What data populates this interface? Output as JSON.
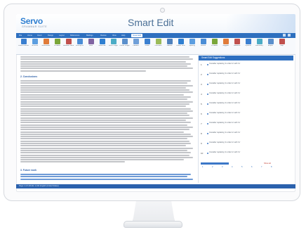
{
  "app": {
    "logo_text": "Servo",
    "logo_subtitle": "GRAMMAR SUITE",
    "title": "Smart Edit"
  },
  "tabs": [
    "File",
    "Home",
    "Insert",
    "Design",
    "Layout",
    "References",
    "Mailings",
    "Review",
    "View",
    "Help",
    "Smart Edit"
  ],
  "ribbon": {
    "buttons": [
      "Check Document",
      "Shortcut",
      "Redundant",
      "Phrases",
      "Misused Words",
      "Acronyms",
      "Lists",
      "Grammar",
      "Word Origin",
      "Check Single",
      "Passive",
      "Tense",
      "Numbers",
      "Names",
      "Check Term",
      "Spelling",
      "Words",
      "Phrases",
      "Suggest",
      "Statistics",
      "Options",
      "Dictionary",
      "Export",
      "Help"
    ]
  },
  "document": {
    "heading_1": "2. Conclusions",
    "heading_2": "3. Future work"
  },
  "panel": {
    "title": "Smart Edit Suggestions",
    "suggestions": [
      {
        "num": "1",
        "text": "Consider replacing 'in order to' with 'to'"
      },
      {
        "num": "2",
        "text": "Consider replacing 'in order to' with 'to'"
      },
      {
        "num": "3",
        "text": "Consider replacing 'in order to' with 'to'"
      },
      {
        "num": "4",
        "text": "Consider replacing 'in order to' with 'to'"
      },
      {
        "num": "5",
        "text": "Consider replacing 'in order to' with 'to'"
      },
      {
        "num": "6",
        "text": "Consider replacing 'in order to' with 'to'"
      },
      {
        "num": "7",
        "text": "Consider replacing 'in order to' with 'to'"
      },
      {
        "num": "8",
        "text": "Consider replacing 'in order to' with 'to'"
      },
      {
        "num": "9",
        "text": "Consider replacing 'in order to' with 'to'"
      },
      {
        "num": "10",
        "text": "Consider replacing 'in order to' with 'to'"
      }
    ],
    "pager_pages": [
      "1",
      "2",
      "3",
      "4",
      "5",
      "6",
      "7",
      "8"
    ],
    "pager_link": "Show all"
  },
  "status": {
    "text": "Page 1 of 6   Words: 2,341   English (United States)"
  },
  "colors": {
    "accent": "#2d6fbf",
    "title": "#4a6f96",
    "logo": "#2f7fd1"
  }
}
